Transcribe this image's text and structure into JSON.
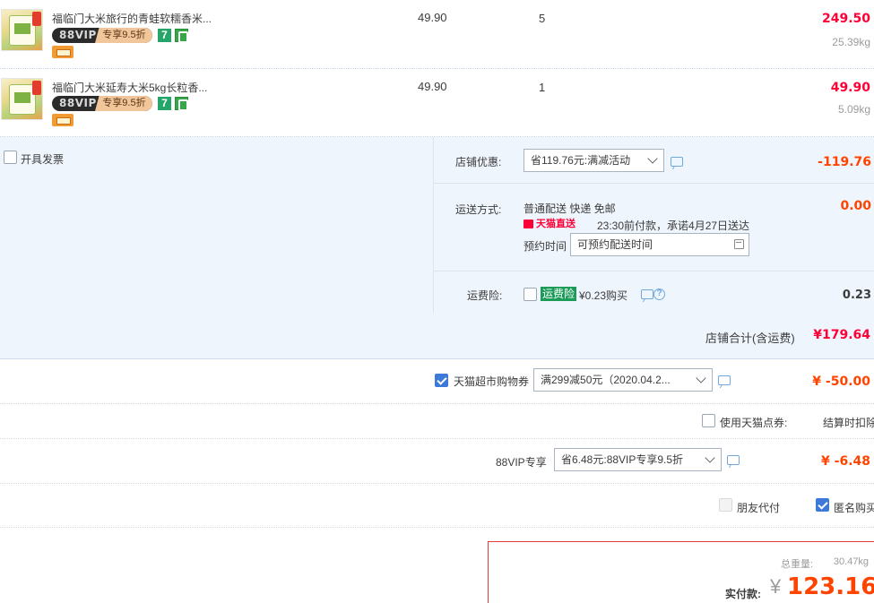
{
  "items": [
    {
      "title": "福临门大米旅行的青蛙软糯香米...",
      "vip_logo": "88VIP",
      "vip_text": "专享9.5折",
      "badge7": "7",
      "price": "49.90",
      "qty": "5",
      "subtotal": "249.50",
      "weight": "25.39kg"
    },
    {
      "title": "福临门大米延寿大米5kg长粒香...",
      "vip_logo": "88VIP",
      "vip_text": "专享9.5折",
      "badge7": "7",
      "price": "49.90",
      "qty": "1",
      "subtotal": "49.90",
      "weight": "5.09kg"
    }
  ],
  "invoice": {
    "label": "开具发票"
  },
  "shop_discount": {
    "label": "店铺优惠:",
    "select": "省119.76元:满减活动",
    "value": "-119.76"
  },
  "shipping": {
    "label": "运送方式:",
    "method": "普通配送 快递 免邮",
    "tmall_direct": "天猫直送",
    "promise": "23:30前付款，承诺4月27日送达",
    "schedule_label": "预约时间",
    "schedule_placeholder": "可预约配送时间",
    "value": "0.00"
  },
  "insurance": {
    "label": "运费险:",
    "badge": "运费险",
    "price_text": "¥0.23购买",
    "help": "?",
    "value": "0.23"
  },
  "shop_total": {
    "label": "店铺合计(含运费)",
    "value": "¥179.64"
  },
  "coupon": {
    "label": "天猫超市购物券",
    "select": "满299减50元（2020.04.2...",
    "value": "¥ -50.00"
  },
  "points": {
    "label": "使用天猫点券:",
    "note": "结算时扣除"
  },
  "vip88": {
    "label": "88VIP专享",
    "select": "省6.48元:88VIP专享9.5折",
    "value": "¥ -6.48"
  },
  "friend_pay": {
    "label": "朋友代付"
  },
  "anonymous": {
    "label": "匿名购买"
  },
  "summary": {
    "weight_label": "总重量:",
    "weight_value": "30.47kg",
    "pay_label": "实付款:",
    "currency": "¥",
    "pay_value": "123.16"
  },
  "colors": {
    "accent_red": "#ff0036",
    "orange_red": "#ff4400",
    "blue": "#3d79d8"
  }
}
